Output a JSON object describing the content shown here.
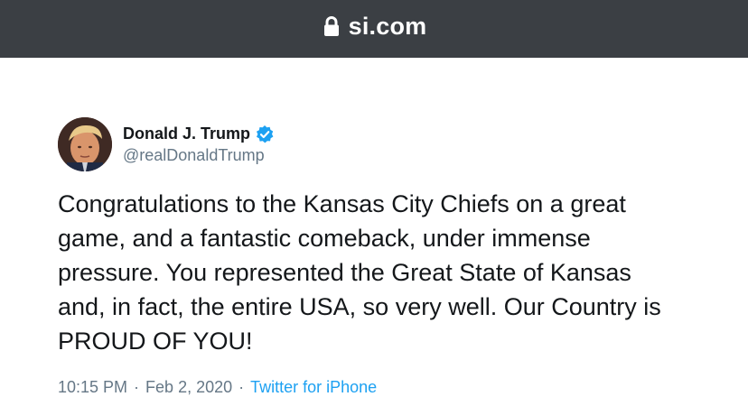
{
  "browser": {
    "domain": "si.com",
    "lock_icon": "lock-icon"
  },
  "tweet": {
    "author": {
      "display_name": "Donald J. Trump",
      "handle": "@realDonaldTrump",
      "verified_icon": "verified-badge-icon",
      "verified_color": "#1da1f2"
    },
    "text": "Congratulations to the Kansas City Chiefs on a great\ngame, and a fantastic comeback, under immense\npressure. You represented the Great State of Kansas\nand, in fact, the entire USA, so very well. Our Country is\nPROUD OF YOU!",
    "time": "10:15 PM",
    "separator": "·",
    "date": "Feb 2, 2020",
    "source": "Twitter for iPhone"
  }
}
